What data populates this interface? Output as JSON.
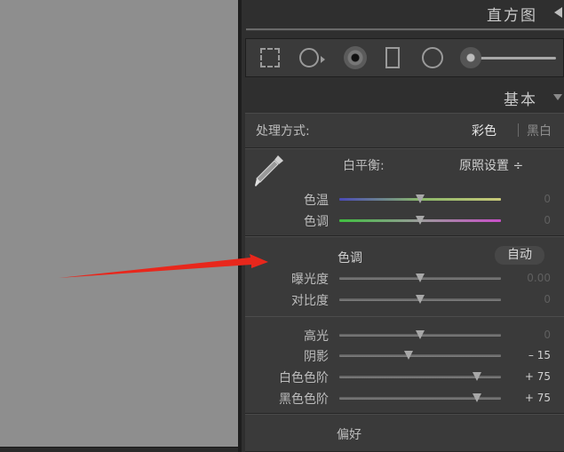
{
  "histogram": {
    "title": "直方图"
  },
  "basic": {
    "title": "基本"
  },
  "treatment": {
    "label": "处理方式:",
    "color": "彩色",
    "bw": "黑白"
  },
  "white_balance": {
    "label": "白平衡:",
    "preset": "原照设置 ÷"
  },
  "sliders": {
    "temp": {
      "label": "色温",
      "value": "0",
      "level": 0.5
    },
    "tint": {
      "label": "色调",
      "value": "0",
      "level": 0.5
    },
    "exposure": {
      "label": "曝光度",
      "value": "0.00",
      "level": 0.5
    },
    "contrast": {
      "label": "对比度",
      "value": "0",
      "level": 0.5
    },
    "highlights": {
      "label": "高光",
      "value": "0",
      "level": 0.5
    },
    "shadows": {
      "label": "阴影",
      "value": "– 15",
      "level": 0.43
    },
    "whites": {
      "label": "白色色阶",
      "value": "+ 75",
      "level": 0.85
    },
    "blacks": {
      "label": "黑色色阶",
      "value": "+ 75",
      "level": 0.85
    }
  },
  "tone": {
    "title": "色调",
    "auto_label": "自动"
  },
  "presence": {
    "title": "偏好"
  },
  "colors": {
    "arrow": "#e8271c",
    "panel": "#3a3a3a"
  }
}
